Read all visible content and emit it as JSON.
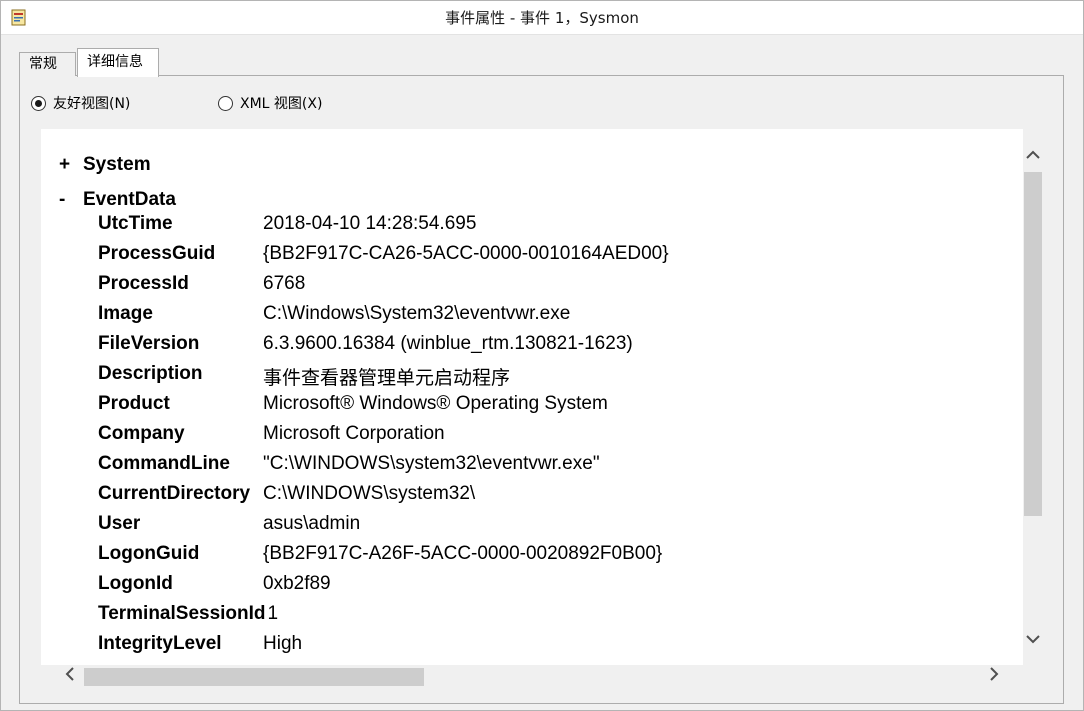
{
  "window": {
    "title": "事件属性 - 事件 1，Sysmon",
    "icon": "event-viewer-icon"
  },
  "tabs": [
    {
      "label": "常规",
      "active": false
    },
    {
      "label": "详细信息",
      "active": true
    }
  ],
  "view_options": {
    "friendly": {
      "label": "友好视图(N)",
      "checked": true
    },
    "xml": {
      "label": "XML 视图(X)",
      "checked": false
    }
  },
  "tree": {
    "system": {
      "toggle": "+",
      "label": "System"
    },
    "eventdata": {
      "toggle": "-",
      "label": "EventData"
    }
  },
  "fields": [
    {
      "key": "UtcTime",
      "value": "2018-04-10 14:28:54.695"
    },
    {
      "key": "ProcessGuid",
      "value": "{BB2F917C-CA26-5ACC-0000-0010164AED00}"
    },
    {
      "key": "ProcessId",
      "value": "6768"
    },
    {
      "key": "Image",
      "value": "C:\\Windows\\System32\\eventvwr.exe"
    },
    {
      "key": "FileVersion",
      "value": "6.3.9600.16384 (winblue_rtm.130821-1623)"
    },
    {
      "key": "Description",
      "value": "事件查看器管理单元启动程序"
    },
    {
      "key": "Product",
      "value": "Microsoft® Windows® Operating System"
    },
    {
      "key": "Company",
      "value": "Microsoft Corporation"
    },
    {
      "key": "CommandLine",
      "value": "\"C:\\WINDOWS\\system32\\eventvwr.exe\""
    },
    {
      "key": "CurrentDirectory",
      "value": "C:\\WINDOWS\\system32\\"
    },
    {
      "key": "User",
      "value": "asus\\admin"
    },
    {
      "key": "LogonGuid",
      "value": "{BB2F917C-A26F-5ACC-0000-0020892F0B00}"
    },
    {
      "key": "LogonId",
      "value": "0xb2f89"
    },
    {
      "key": "TerminalSessionId",
      "value": "1"
    },
    {
      "key": "IntegrityLevel",
      "value": "High"
    }
  ],
  "scroll": {
    "up_icon": "chevron-up-icon",
    "down_icon": "chevron-down-icon",
    "left_icon": "chevron-left-icon",
    "right_icon": "chevron-right-icon"
  }
}
